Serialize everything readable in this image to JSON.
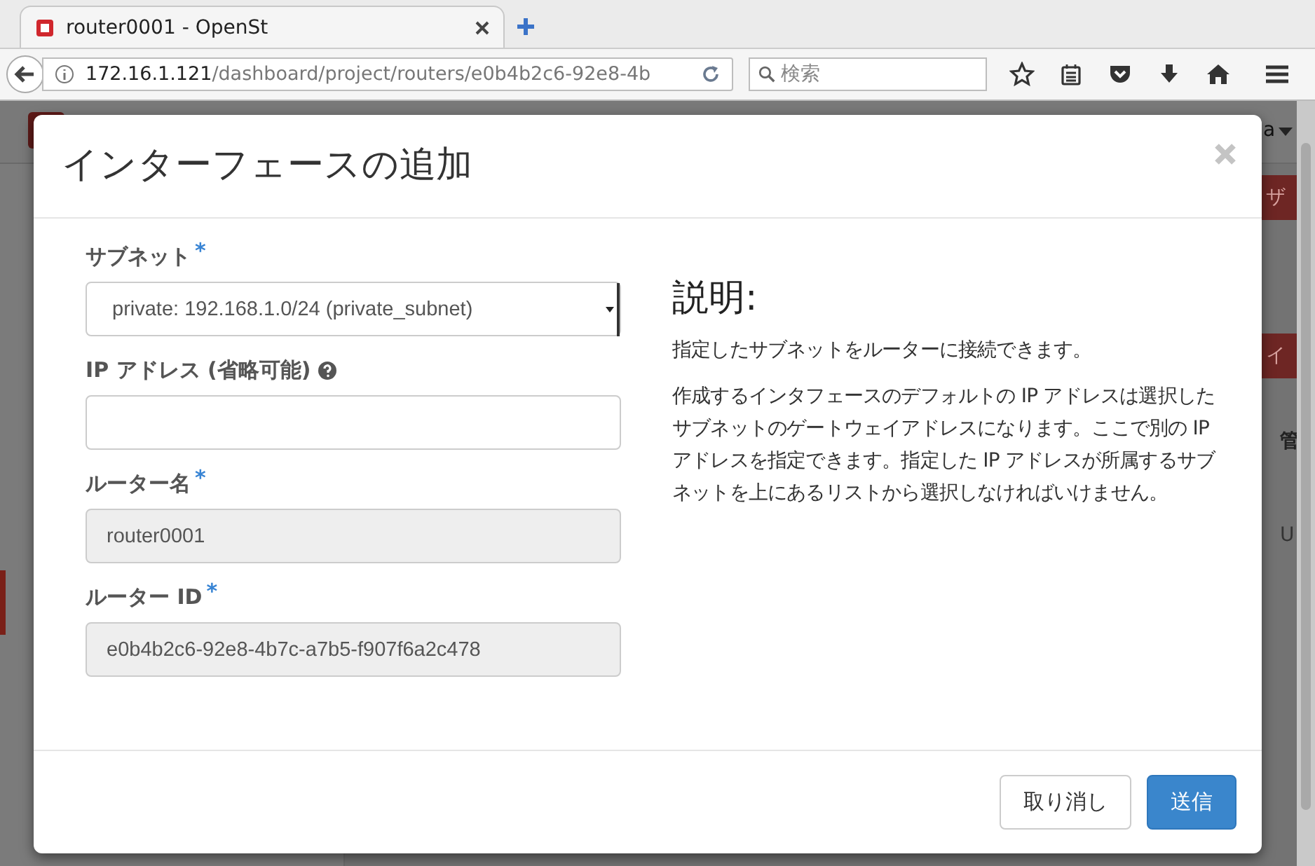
{
  "browser": {
    "tab_title": "router0001 - OpenSt",
    "url_host": "172.16.1.121",
    "url_path": "/dashboard/project/routers/e0b4b2c6-92e8-4b",
    "search_placeholder": "検索"
  },
  "background": {
    "user_menu": "a",
    "fragments": [
      {
        "kind": "button",
        "text": "ザ"
      },
      {
        "kind": "button",
        "text": "イ"
      },
      {
        "kind": "heading",
        "text": "管"
      },
      {
        "kind": "cell",
        "text": "U"
      }
    ]
  },
  "dialog": {
    "title": "インターフェースの追加",
    "required_mark": "*",
    "fields": [
      {
        "label": "サブネット",
        "required": true,
        "help": false,
        "kind": "select",
        "disabled": false,
        "value": "private: 192.168.1.0/24 (private_subnet)"
      },
      {
        "label": "IP アドレス (省略可能)",
        "required": false,
        "help": true,
        "kind": "text",
        "disabled": false
      },
      {
        "label": "ルーター名",
        "required": true,
        "help": false,
        "kind": "text",
        "disabled": true,
        "value": "router0001"
      },
      {
        "label": "ルーター ID",
        "required": true,
        "help": false,
        "kind": "text",
        "disabled": true,
        "value": "e0b4b2c6-92e8-4b7c-a7b5-f907f6a2c478"
      }
    ],
    "description": {
      "heading": "説明:",
      "paragraphs": [
        "指定したサブネットをルーターに接続できます。",
        "作成するインタフェースのデフォルトの IP アドレスは選択したサブネットのゲートウェイアドレスになります。ここで別の IP アドレスを指定できます。指定した IP アドレスが所属するサブネットを上にあるリストから選択しなければいけません。"
      ]
    },
    "buttons": [
      {
        "label": "取り消し",
        "kind": "default"
      },
      {
        "label": "送信",
        "kind": "primary"
      }
    ]
  }
}
